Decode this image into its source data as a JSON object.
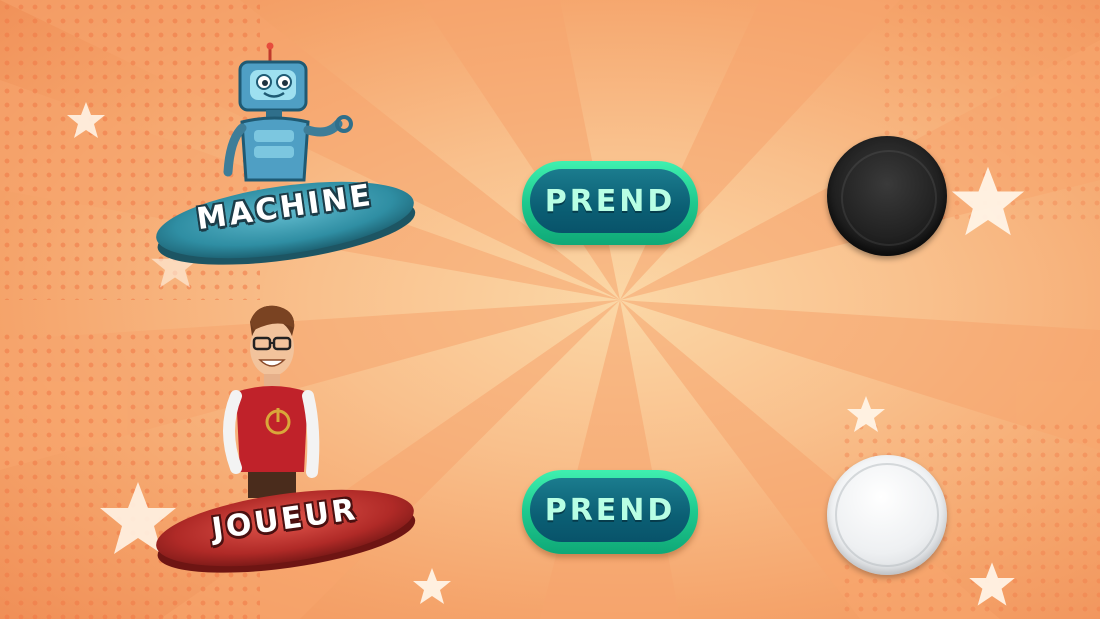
{
  "colors": {
    "background": "#f9c08c",
    "machine_plate": "#2f8ea3",
    "player_plate": "#b02a27",
    "button_outer": "#1fc98e",
    "button_inner": "#0b5f74",
    "button_text": "#b8ffe4"
  },
  "machine": {
    "label": "MACHINE",
    "avatar": "robot-icon",
    "button_label": "PREND",
    "piece": "black"
  },
  "player": {
    "label": "JOUEUR",
    "avatar": "player-avatar-icon",
    "button_label": "PREND",
    "piece": "white"
  }
}
